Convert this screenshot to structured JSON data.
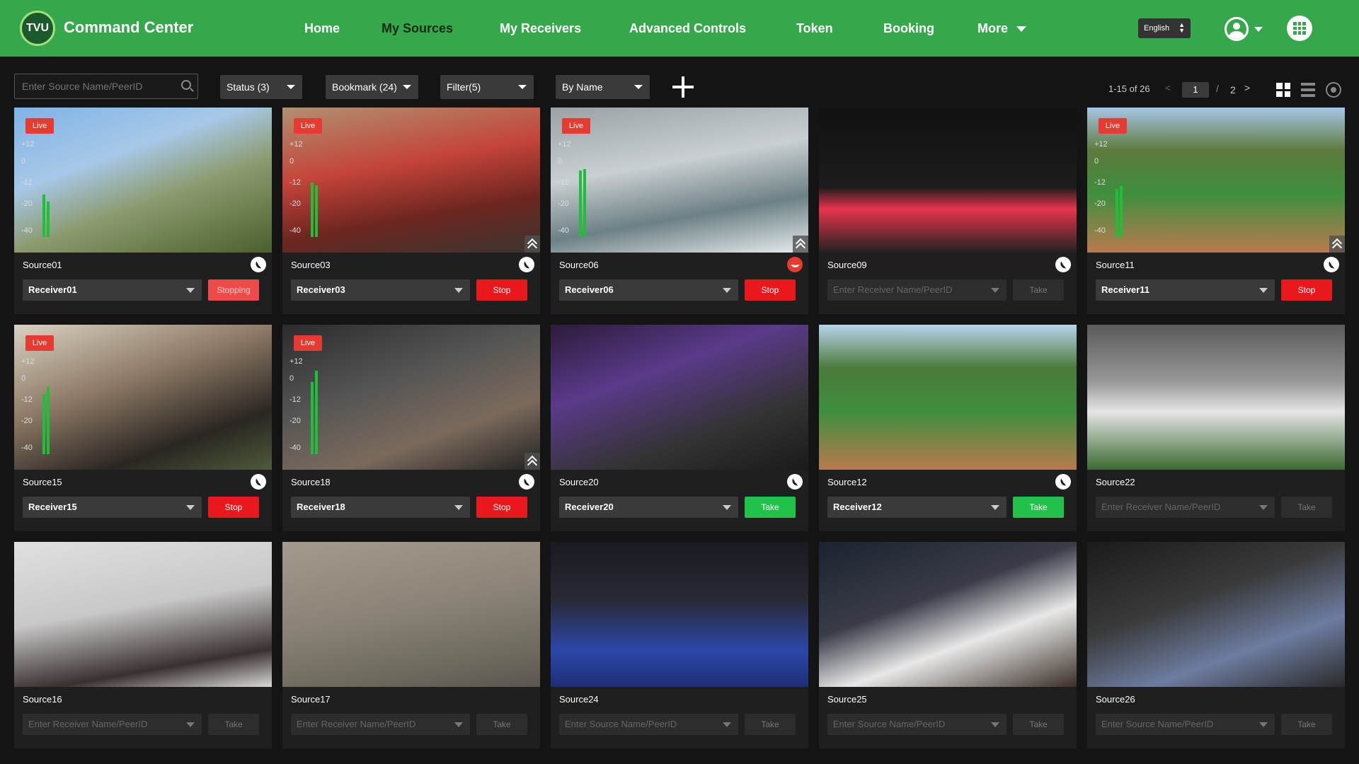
{
  "header": {
    "logo_text": "TVU",
    "title": "Command Center",
    "nav": [
      {
        "label": "Home",
        "active": false
      },
      {
        "label": "My Sources",
        "active": true
      },
      {
        "label": "My Receivers",
        "active": false
      },
      {
        "label": "Advanced Controls",
        "active": false
      },
      {
        "label": "Token",
        "active": false
      },
      {
        "label": "Booking",
        "active": false
      },
      {
        "label": "More",
        "active": false
      }
    ],
    "language": "English",
    "brand_color": "#36a84c"
  },
  "toolbar": {
    "search_placeholder": "Enter Source Name/PeerID",
    "status_filter": "Status (3)",
    "bookmark_filter": "Bookmark (24)",
    "filter": "Filter(5)",
    "sort": "By Name",
    "pagination": {
      "range": "1-15 of 26",
      "current_page": "1",
      "separator": "/",
      "total_pages": "2",
      "prev": "<",
      "next": ">"
    }
  },
  "meter_labels": [
    "+12",
    "0",
    "-12",
    "-20",
    "-40"
  ],
  "cards": [
    {
      "source": "Source01",
      "receiver": "Receiver01",
      "button": "Stopping",
      "live": "Live",
      "phone": "white"
    },
    {
      "source": "Source03",
      "receiver": "Receiver03",
      "button": "Stop",
      "live": "Live",
      "phone": "white"
    },
    {
      "source": "Source06",
      "receiver": "Receiver06",
      "button": "Stop",
      "live": "Live",
      "phone": "red"
    },
    {
      "source": "Source09",
      "receiver": "Enter Receiver Name/PeerID",
      "button": "Take",
      "live": "",
      "phone": "white"
    },
    {
      "source": "Source11",
      "receiver": "Receiver11",
      "button": "Stop",
      "live": "Live",
      "phone": "white"
    },
    {
      "source": "Source15",
      "receiver": "Receiver15",
      "button": "Stop",
      "live": "Live",
      "phone": "white"
    },
    {
      "source": "Source18",
      "receiver": "Receiver18",
      "button": "Stop",
      "live": "Live",
      "phone": "white"
    },
    {
      "source": "Source20",
      "receiver": "Receiver20",
      "button": "Take",
      "live": "",
      "phone": "white"
    },
    {
      "source": "Source12",
      "receiver": "Receiver12",
      "button": "Take",
      "live": "",
      "phone": "white"
    },
    {
      "source": "Source22",
      "receiver": "Enter Receiver Name/PeerID",
      "button": "Take",
      "live": "",
      "phone": ""
    },
    {
      "source": "Source16",
      "receiver": "Enter Receiver Name/PeerID",
      "button": "Take",
      "live": "",
      "phone": ""
    },
    {
      "source": "Source17",
      "receiver": "Enter Receiver Name/PeerID",
      "button": "Take",
      "live": "",
      "phone": ""
    },
    {
      "source": "Source24",
      "receiver": "Enter Source Name/PeerID",
      "button": "Take",
      "live": "",
      "phone": ""
    },
    {
      "source": "Source25",
      "receiver": "Enter Source Name/PeerID",
      "button": "Take",
      "live": "",
      "phone": ""
    },
    {
      "source": "Source26",
      "receiver": "Enter Source Name/PeerID",
      "button": "Take",
      "live": "",
      "phone": ""
    }
  ]
}
